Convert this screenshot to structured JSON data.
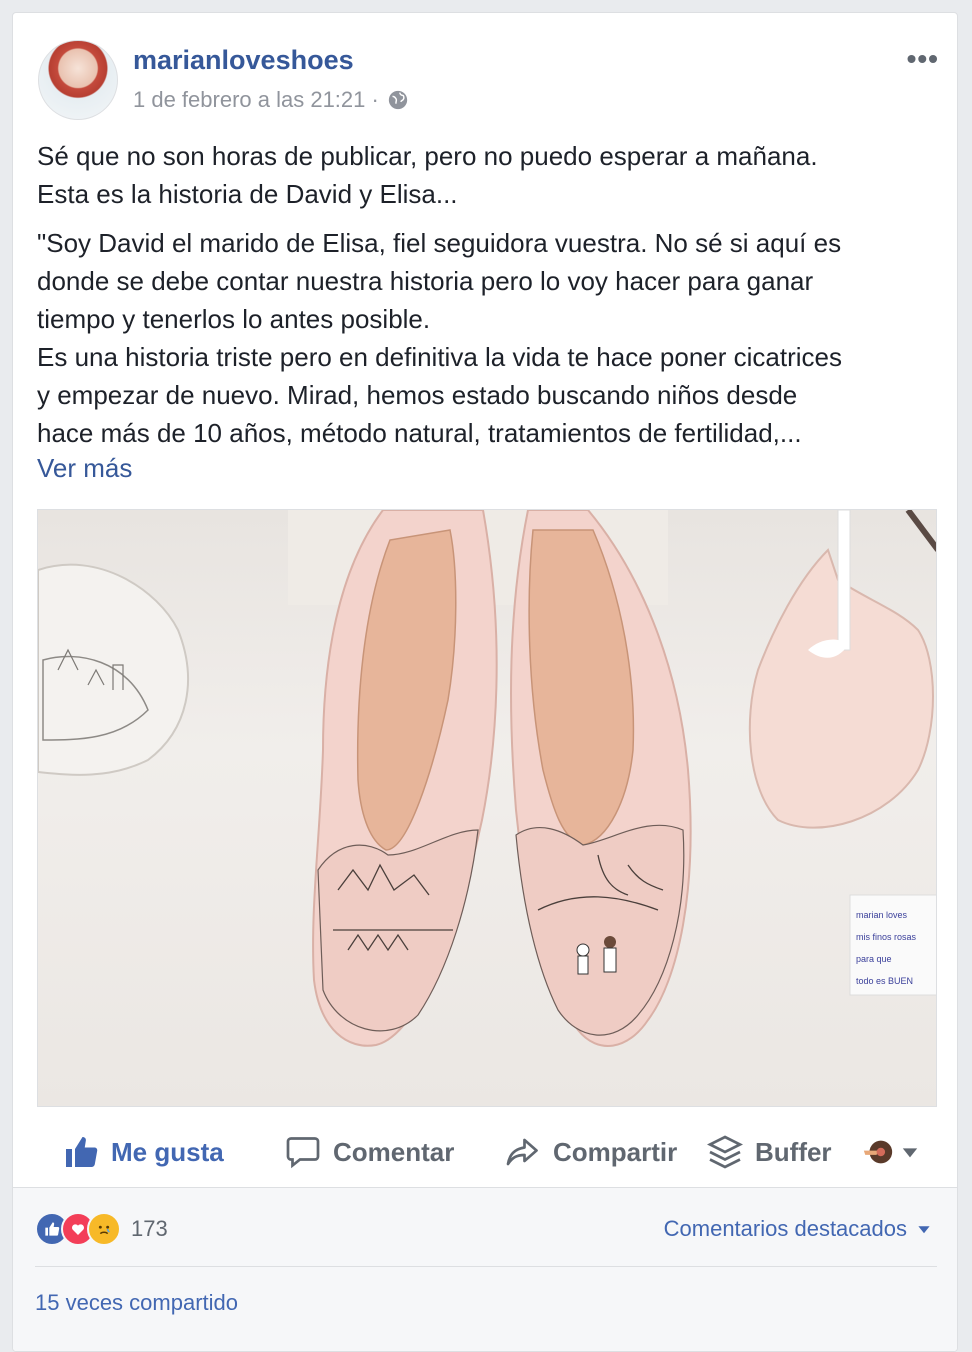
{
  "post": {
    "author": "marianloveshoes",
    "timestamp": "1 de febrero a las 21:21 ·",
    "more_label": "•••",
    "paragraph1_line1": "Sé que no son horas de publicar, pero no puedo esperar a mañana.",
    "paragraph1_line2": "Esta es la historia de David y Elisa...",
    "paragraph2_lines": [
      "\"Soy David el marido de Elisa, fiel seguidora vuestra. No sé si aquí es",
      "donde se debe contar nuestra historia pero lo voy hacer para ganar",
      "tiempo y tenerlos lo antes posible.",
      "Es una historia triste pero en definitiva la vida te hace poner cicatrices",
      "y empezar de nuevo. Mirad, hemos estado buscando niños desde",
      "hace más de 10 años, método natural, tratamientos de fertilidad,..."
    ],
    "see_more": "Ver más",
    "photo_note_lines": [
      "marian loves",
      "mis finos rosas",
      "para que",
      "todo es BUEN"
    ]
  },
  "actions": {
    "like": "Me gusta",
    "comment": "Comentar",
    "share": "Compartir",
    "buffer": "Buffer"
  },
  "summary": {
    "reaction_count": "173",
    "top_comments": "Comentarios destacados",
    "shares": "15 veces compartido"
  },
  "colors": {
    "link": "#365899",
    "like_blue": "#4267b2",
    "love_red": "#f33e58",
    "sad_yellow": "#f7b928"
  },
  "icons": [
    "globe-icon",
    "thumbs-up-icon",
    "comment-icon",
    "share-icon",
    "buffer-icon",
    "caret-down-icon"
  ]
}
